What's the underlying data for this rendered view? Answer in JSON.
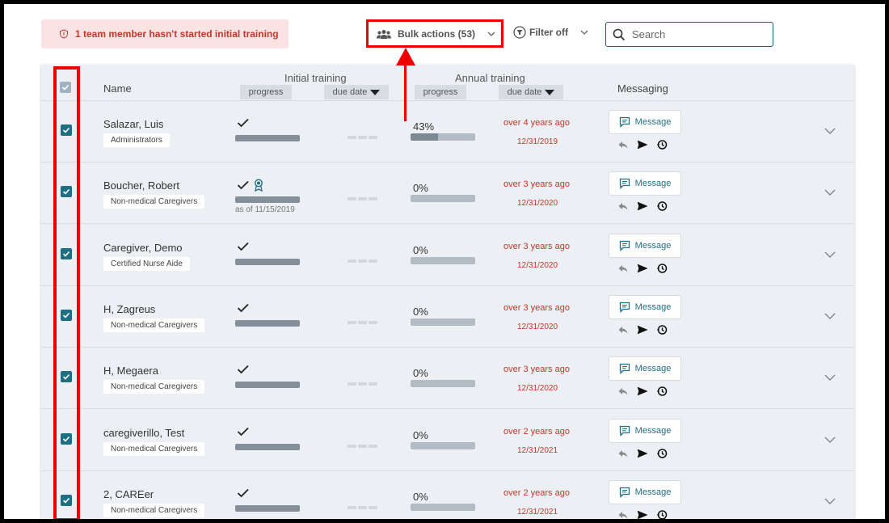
{
  "alert": {
    "text": "1 team member hasn't started initial training",
    "icon": "shield-alert-icon"
  },
  "toolbar": {
    "bulk_actions_label": "Bulk actions (53)",
    "filter_label": "Filter off",
    "search_placeholder": "Search"
  },
  "table": {
    "columns": {
      "name": "Name",
      "initial_training": "Initial training",
      "annual_training": "Annual training",
      "progress": "progress",
      "due_date": "due date",
      "messaging": "Messaging"
    },
    "message_label": "Message",
    "rows": [
      {
        "name": "Salazar, Luis",
        "role": "Administrators",
        "initial_complete": true,
        "certificate": false,
        "as_of": "",
        "annual_pct": "43%",
        "annual_progress": 0.43,
        "overdue": "over 4 years ago",
        "due": "12/31/2019",
        "checked": true
      },
      {
        "name": "Boucher, Robert",
        "role": "Non-medical Caregivers",
        "initial_complete": true,
        "certificate": true,
        "as_of": "as of 11/15/2019",
        "annual_pct": "0%",
        "annual_progress": 0,
        "overdue": "over 3 years ago",
        "due": "12/31/2020",
        "checked": true
      },
      {
        "name": "Caregiver, Demo",
        "role": "Certified Nurse Aide",
        "initial_complete": true,
        "certificate": false,
        "as_of": "",
        "annual_pct": "0%",
        "annual_progress": 0,
        "overdue": "over 3 years ago",
        "due": "12/31/2020",
        "checked": true
      },
      {
        "name": "H, Zagreus",
        "role": "Non-medical Caregivers",
        "initial_complete": true,
        "certificate": false,
        "as_of": "",
        "annual_pct": "0%",
        "annual_progress": 0,
        "overdue": "over 3 years ago",
        "due": "12/31/2020",
        "checked": true
      },
      {
        "name": "H, Megaera",
        "role": "Non-medical Caregivers",
        "initial_complete": true,
        "certificate": false,
        "as_of": "",
        "annual_pct": "0%",
        "annual_progress": 0,
        "overdue": "over 3 years ago",
        "due": "12/31/2020",
        "checked": true
      },
      {
        "name": "caregiverillo, Test",
        "role": "Non-medical Caregivers",
        "initial_complete": true,
        "certificate": false,
        "as_of": "",
        "annual_pct": "0%",
        "annual_progress": 0,
        "overdue": "over 2 years ago",
        "due": "12/31/2021",
        "checked": true
      },
      {
        "name": "2, CAREer",
        "role": "Non-medical Caregivers",
        "initial_complete": true,
        "certificate": false,
        "as_of": "",
        "annual_pct": "0%",
        "annual_progress": 0,
        "overdue": "over 2 years ago",
        "due": "12/31/2021",
        "checked": true
      }
    ]
  },
  "colors": {
    "accent": "#1f6f84",
    "danger": "#c0392b",
    "annotation": "#e00000"
  }
}
